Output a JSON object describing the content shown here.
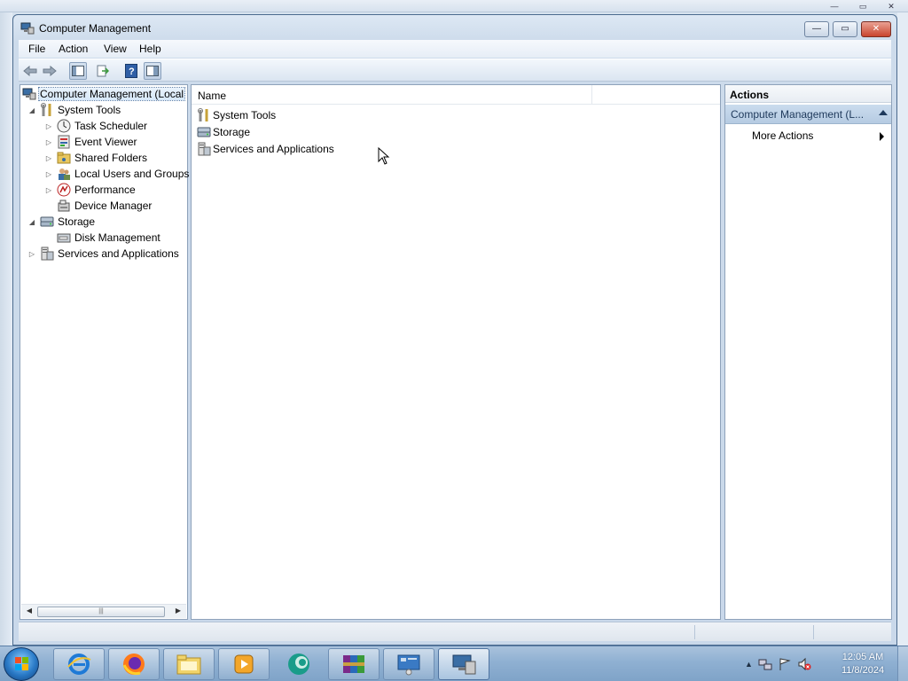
{
  "window": {
    "title": "Computer Management"
  },
  "menu": [
    "File",
    "Action",
    "View",
    "Help"
  ],
  "tree": {
    "root": "Computer Management (Local",
    "system_tools": "System Tools",
    "task_scheduler": "Task Scheduler",
    "event_viewer": "Event Viewer",
    "shared_folders": "Shared Folders",
    "local_users": "Local Users and Groups",
    "performance": "Performance",
    "device_manager": "Device Manager",
    "storage": "Storage",
    "disk_management": "Disk Management",
    "services_apps": "Services and Applications"
  },
  "content": {
    "column_name": "Name",
    "rows": [
      "System Tools",
      "Storage",
      "Services and Applications"
    ]
  },
  "actions": {
    "header": "Actions",
    "section": "Computer Management (L...",
    "more": "More Actions"
  },
  "taskbar": {
    "time": "12:05 AM",
    "date": "11/8/2024"
  }
}
